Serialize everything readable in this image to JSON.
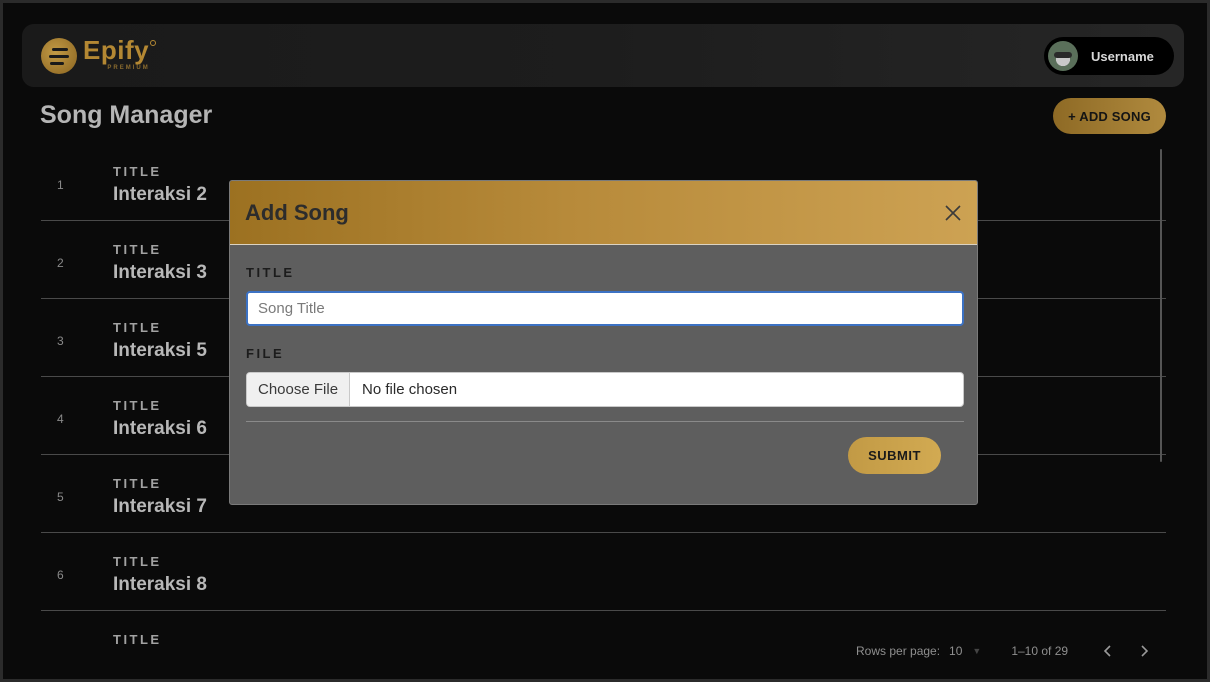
{
  "navbar": {
    "brand_name": "Epify",
    "brand_sub": "PREMIUM",
    "username": "Username"
  },
  "page": {
    "title": "Song Manager",
    "add_song_label": "+ ADD SONG"
  },
  "songs": [
    {
      "num": "1",
      "label": "TITLE",
      "title": "Interaksi 2"
    },
    {
      "num": "2",
      "label": "TITLE",
      "title": "Interaksi 3"
    },
    {
      "num": "3",
      "label": "TITLE",
      "title": "Interaksi 5"
    },
    {
      "num": "4",
      "label": "TITLE",
      "title": "Interaksi 6"
    },
    {
      "num": "5",
      "label": "TITLE",
      "title": "Interaksi 7"
    },
    {
      "num": "6",
      "label": "TITLE",
      "title": "Interaksi 8"
    },
    {
      "num": "",
      "label": "TITLE",
      "title": ""
    }
  ],
  "pagination": {
    "rows_label": "Rows per page:",
    "rows_value": "10",
    "range": "1–10 of 29"
  },
  "modal": {
    "title": "Add Song",
    "title_label": "TITLE",
    "title_placeholder": "Song Title",
    "file_label": "FILE",
    "choose_file": "Choose File",
    "file_status": "No file chosen",
    "submit": "SUBMIT"
  },
  "colors": {
    "accent": "#b48833",
    "background": "#0a0a0a",
    "modal_bg": "#5e5e5e"
  },
  "icons": {
    "menu": "hamburger-icon",
    "close": "close-icon",
    "prev": "chevron-left-icon",
    "next": "chevron-right-icon"
  }
}
